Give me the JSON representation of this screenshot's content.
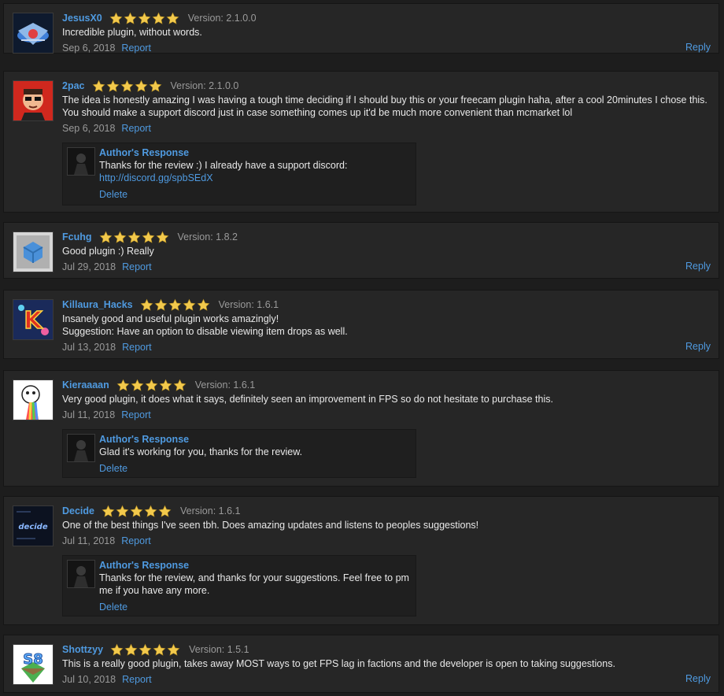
{
  "colors": {
    "link": "#4f9ae0",
    "star": "#f2c94c",
    "muted": "#9a9a9a",
    "panel": "#262626"
  },
  "icons": {
    "star": "star-icon",
    "avatar": "user-avatar",
    "author_avatar": "author-avatar"
  },
  "reviews": [
    {
      "user": "JesusX0",
      "rating": 5,
      "version": "Version: 2.1.0.0",
      "body": "Incredible plugin, without words.",
      "date": "Sep 6, 2018",
      "report": "Report",
      "reply": "Reply"
    },
    {
      "user": "2pac",
      "rating": 5,
      "version": "Version: 2.1.0.0",
      "body": "The idea is honestly amazing I was having a tough time deciding if I should buy this or your freecam plugin haha, after a cool 20minutes I chose this. You should make a support discord just in case something comes up it'd be much more convenient than mcmarket lol",
      "date": "Sep 6, 2018",
      "report": "Report",
      "response": {
        "title": "Author's Response",
        "text": "Thanks for the review :) I already have a support discord:",
        "link": "http://discord.gg/spbSEdX",
        "delete": "Delete"
      }
    },
    {
      "user": "Fcuhg",
      "rating": 5,
      "version": "Version: 1.8.2",
      "body": "Good plugin :) Really",
      "date": "Jul 29, 2018",
      "report": "Report",
      "reply": "Reply"
    },
    {
      "user": "Killaura_Hacks",
      "rating": 5,
      "version": "Version: 1.6.1",
      "body": "Insanely good and useful plugin works amazingly!",
      "body2": "Suggestion: Have an option to disable viewing item drops as well.",
      "date": "Jul 13, 2018",
      "report": "Report",
      "reply": "Reply"
    },
    {
      "user": "Kieraaaan",
      "rating": 5,
      "version": "Version: 1.6.1",
      "body": "Very good plugin, it does what it says, definitely seen an improvement in FPS so do not hesitate to purchase this.",
      "date": "Jul 11, 2018",
      "report": "Report",
      "response": {
        "title": "Author's Response",
        "text": "Glad it's working for you, thanks for the review.",
        "delete": "Delete"
      }
    },
    {
      "user": "Decide",
      "rating": 5,
      "version": "Version: 1.6.1",
      "body": "One of the best things I've seen tbh. Does amazing updates and listens to peoples suggestions!",
      "date": "Jul 11, 2018",
      "report": "Report",
      "avatar_text": "decide",
      "response": {
        "title": "Author's Response",
        "text": "Thanks for the review, and thanks for your suggestions. Feel free to pm me if you have any more.",
        "delete": "Delete"
      }
    },
    {
      "user": "Shottzyy",
      "rating": 5,
      "version": "Version: 1.5.1",
      "body": "This is a really good plugin, takes away MOST ways to get FPS lag in factions and the developer is open to taking suggestions.",
      "date": "Jul 10, 2018",
      "report": "Report",
      "reply": "Reply",
      "avatar_text": "S8"
    }
  ]
}
